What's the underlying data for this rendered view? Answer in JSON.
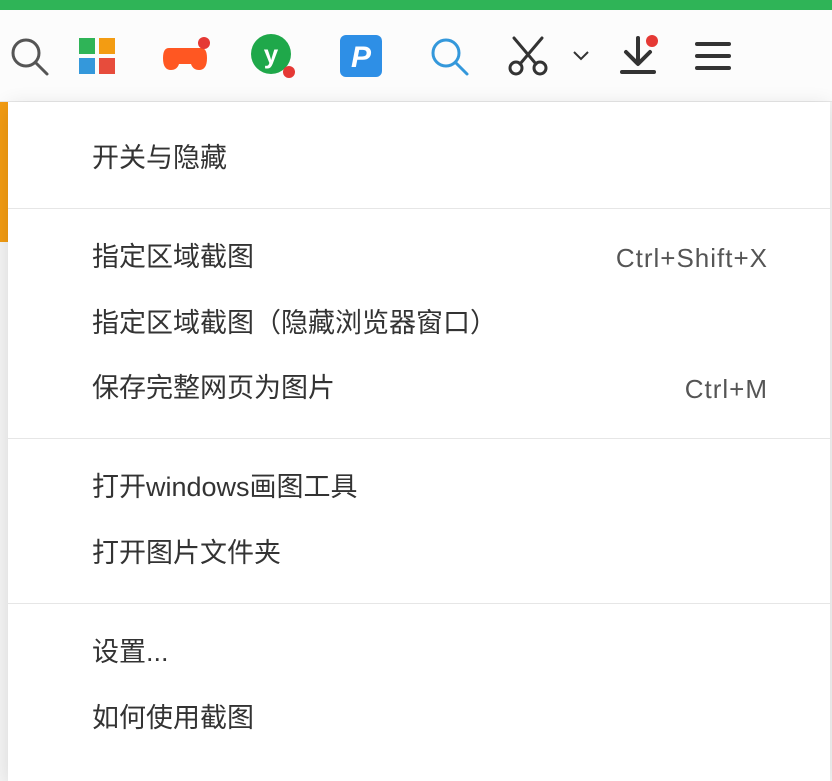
{
  "toolbar": {
    "icons": {
      "search": "search-icon",
      "tiles": "windows-tiles-icon",
      "gamepad": "gamepad-icon",
      "y": "y-circle-icon",
      "p": "p-tile-icon",
      "search2": "search-circle-icon",
      "scissors": "scissors-icon",
      "dropdown": "chevron-down-icon",
      "download": "download-icon",
      "hamburger": "hamburger-icon"
    }
  },
  "menu": {
    "group1": [
      {
        "label": "开关与隐藏",
        "shortcut": ""
      }
    ],
    "group2": [
      {
        "label": "指定区域截图",
        "shortcut": "Ctrl+Shift+X"
      },
      {
        "label": "指定区域截图（隐藏浏览器窗口）",
        "shortcut": ""
      },
      {
        "label": "保存完整网页为图片",
        "shortcut": "Ctrl+M"
      }
    ],
    "group3": [
      {
        "label": "打开windows画图工具",
        "shortcut": ""
      },
      {
        "label": "打开图片文件夹",
        "shortcut": ""
      }
    ],
    "group4": [
      {
        "label": "设置...",
        "shortcut": ""
      },
      {
        "label": "如何使用截图",
        "shortcut": ""
      }
    ]
  }
}
